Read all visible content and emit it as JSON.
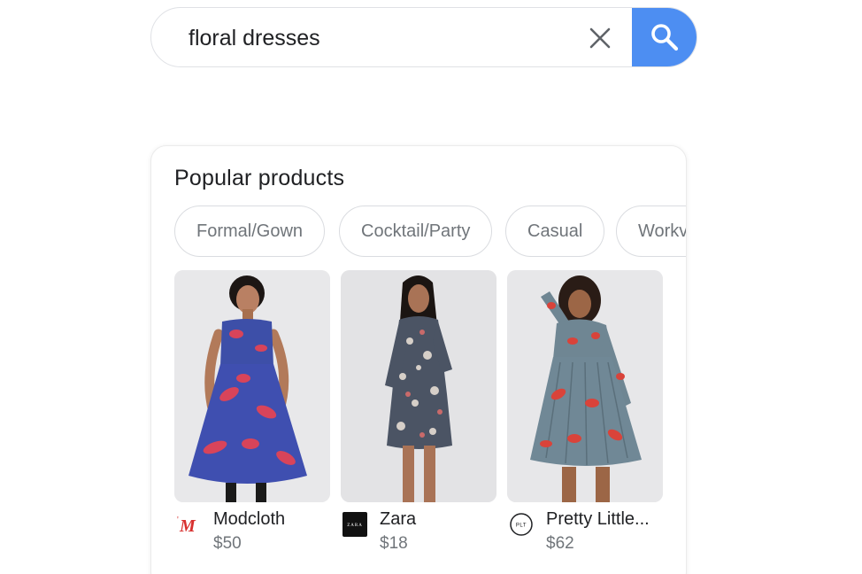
{
  "search": {
    "query": "floral dresses",
    "clear_icon": "close-icon",
    "search_icon": "search-icon",
    "accent_color": "#4d8ef2"
  },
  "popular": {
    "title": "Popular products",
    "chips": [
      {
        "label": "Formal/Gown"
      },
      {
        "label": "Cocktail/Party"
      },
      {
        "label": "Casual"
      },
      {
        "label": "Workv"
      }
    ],
    "products": [
      {
        "store": "Modcloth",
        "price": "$50",
        "logo": "modcloth-logo",
        "logo_text": "M"
      },
      {
        "store": "Zara",
        "price": "$18",
        "logo": "zara-logo",
        "logo_text": "ZARA"
      },
      {
        "store": "Pretty Little...",
        "price": "$62",
        "logo": "plt-logo",
        "logo_text": "PLT"
      }
    ]
  }
}
